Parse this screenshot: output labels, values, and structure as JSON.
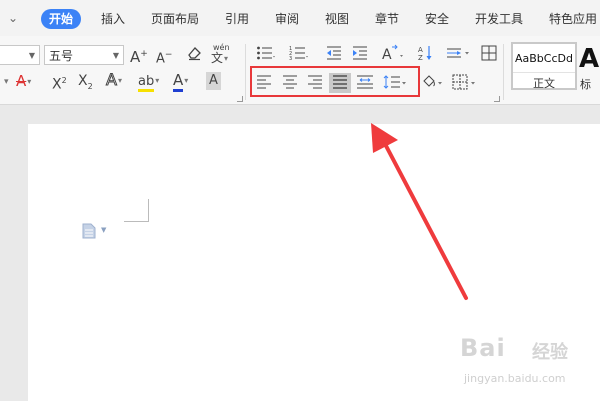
{
  "tabbar": {
    "more_arrow": "⌄",
    "tabs": [
      {
        "label": "开始",
        "active": true
      },
      {
        "label": "插入"
      },
      {
        "label": "页面布局"
      },
      {
        "label": "引用"
      },
      {
        "label": "审阅"
      },
      {
        "label": "视图"
      },
      {
        "label": "章节"
      },
      {
        "label": "安全"
      },
      {
        "label": "开发工具"
      },
      {
        "label": "特色应用"
      }
    ]
  },
  "font": {
    "size_value": "五号",
    "grow_label": "A",
    "shrink_label": "A",
    "phonetic_label": "wén",
    "superscript_label": "X",
    "subscript_label": "X",
    "text_effect_label": "A",
    "highlight_label": "ab",
    "font_color_label": "A",
    "char_shade_label": "A",
    "strike_label": "A"
  },
  "styles": {
    "sample": "AaBbCcDd",
    "name": "正文",
    "next_sample": "Aa",
    "next_name": "标"
  },
  "watermark": {
    "brand": "Bai",
    "suffix": "经验",
    "url": "jingyan.baidu.com"
  },
  "colors": {
    "tab_active": "#3b82f6",
    "highlight_border": "#e8383a",
    "arrow": "#ef3b3d",
    "font_color": "#1f3fd1",
    "highlight_color": "#f7e000"
  }
}
